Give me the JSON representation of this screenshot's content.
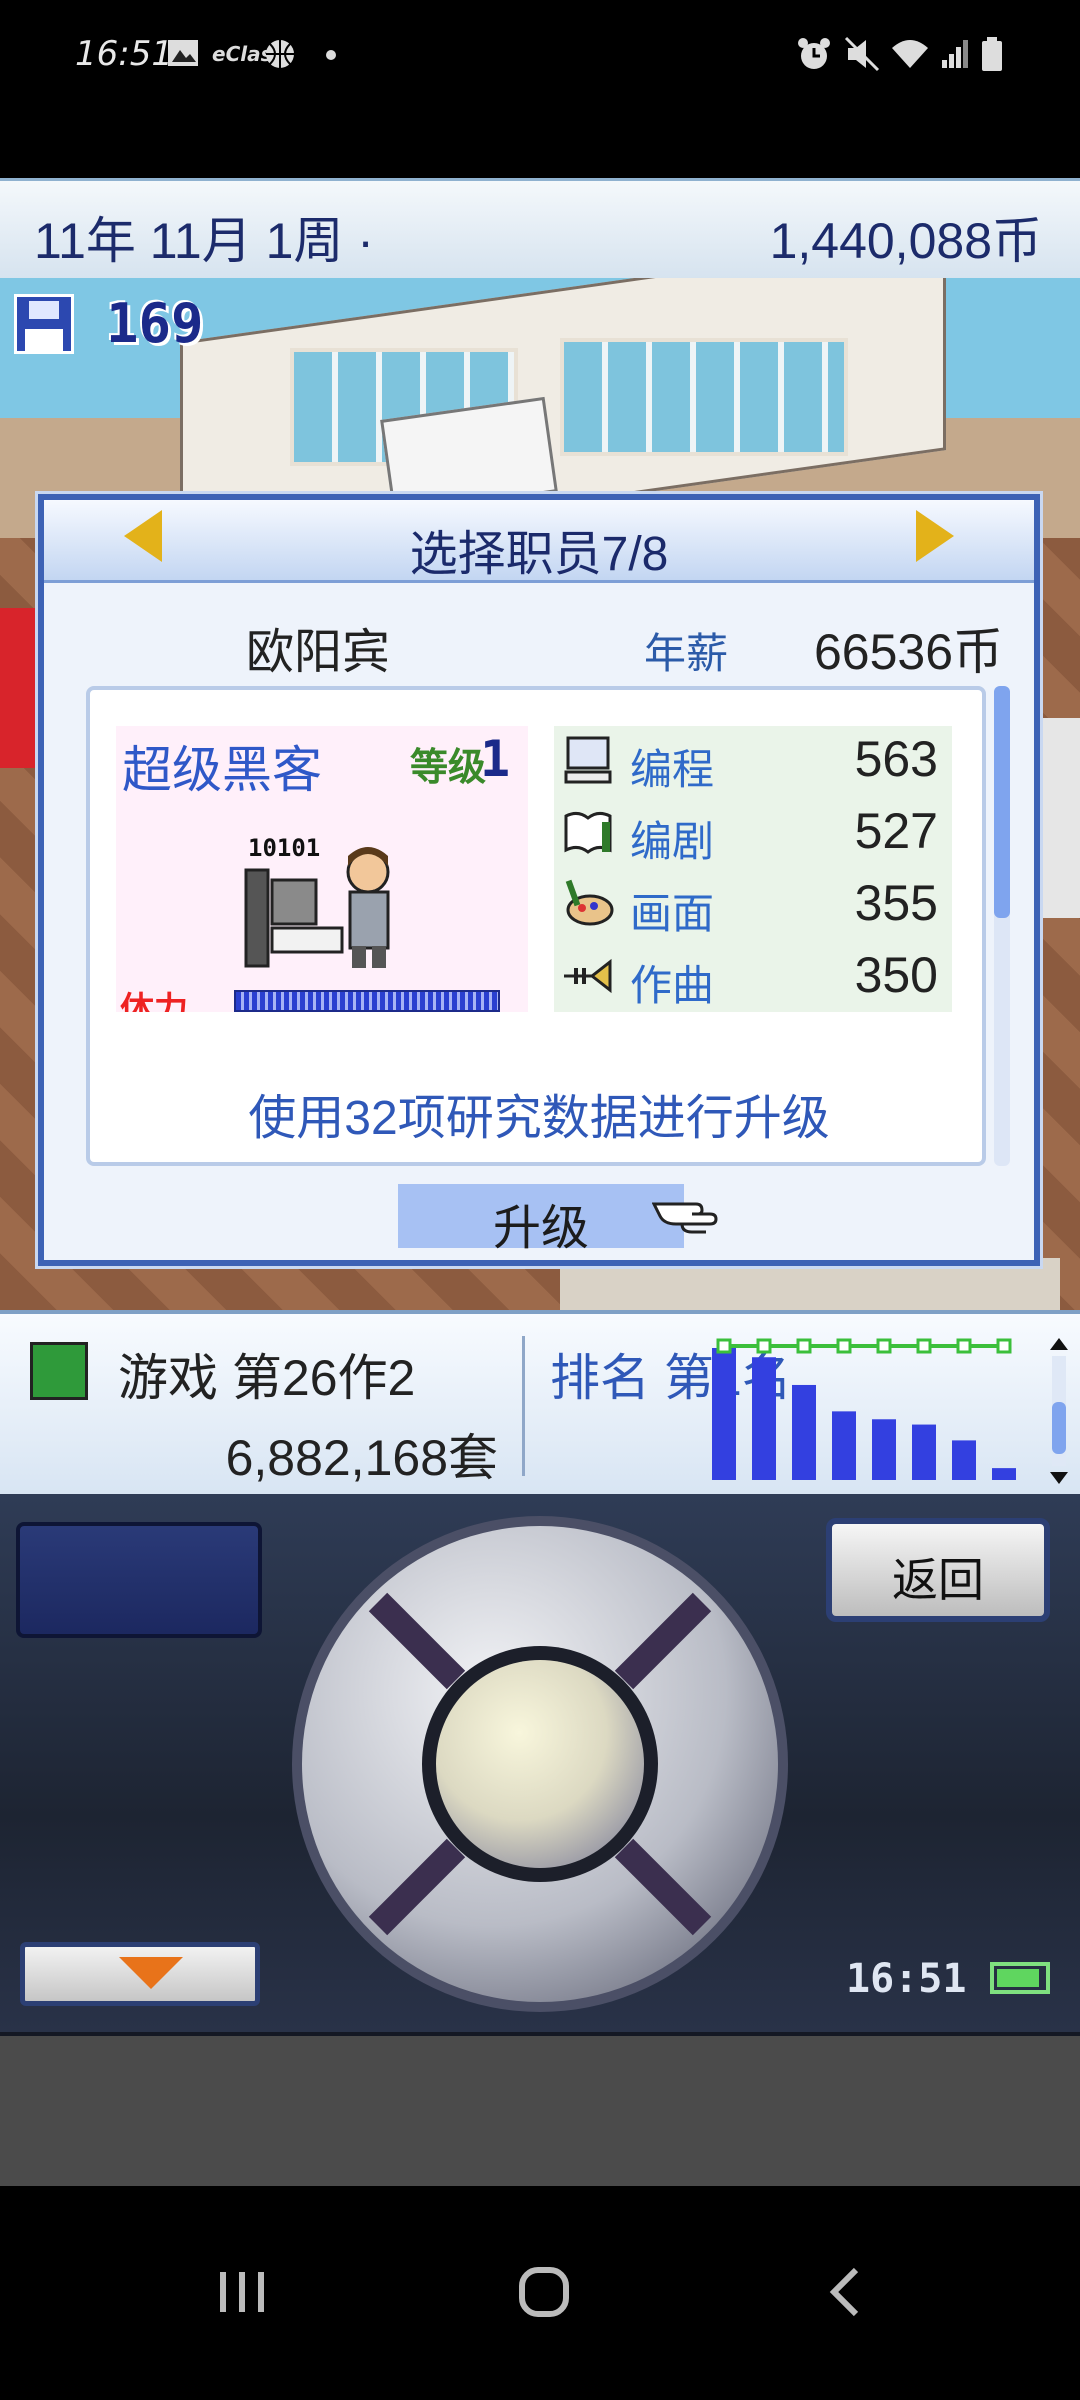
{
  "status_bar": {
    "time": "16:51",
    "icons": [
      "image-icon",
      "eclass-icon",
      "basketball-icon",
      "dot-icon"
    ],
    "eclass_label": "eClass",
    "right_icons": [
      "alarm-icon",
      "mute-icon",
      "wifi-icon",
      "signal-icon",
      "battery-icon"
    ]
  },
  "topbar": {
    "date": "11年 11月 1周 ·",
    "money": "1,440,088币"
  },
  "save": {
    "count": "169"
  },
  "dialog": {
    "title": "选择职员7/8",
    "staff_name": "欧阳宾",
    "salary_label": "年薪",
    "salary": "66536币",
    "job_title": "超级黑客",
    "level_label": "等级",
    "level": "1",
    "sprite_caption": "10101",
    "stamina_label": "体力",
    "stamina": 1.0,
    "stats": [
      {
        "name": "编程",
        "value": "563",
        "icon": "computer-icon"
      },
      {
        "name": "编剧",
        "value": "527",
        "icon": "book-icon"
      },
      {
        "name": "画面",
        "value": "355",
        "icon": "palette-icon"
      },
      {
        "name": "作曲",
        "value": "350",
        "icon": "trumpet-icon"
      }
    ],
    "upgrade_message": "使用32项研究数据进行升级",
    "upgrade_button": "升级"
  },
  "infobar": {
    "game_name": "游戏 第26作2",
    "sales": "6,882,168套",
    "rank_label": "排名 第1名",
    "rank_values": [
      1.0,
      0.93,
      0.72,
      0.52,
      0.46,
      0.42,
      0.3,
      0.09
    ]
  },
  "controller": {
    "back_button": "返回",
    "clock": "16:51"
  },
  "colors": {
    "accent": "#3d62b5",
    "title_text": "#1b2a6b",
    "stat_label": "#2f6ac9",
    "stamina_label": "#e22222",
    "down_arrow": "#e8731a"
  }
}
